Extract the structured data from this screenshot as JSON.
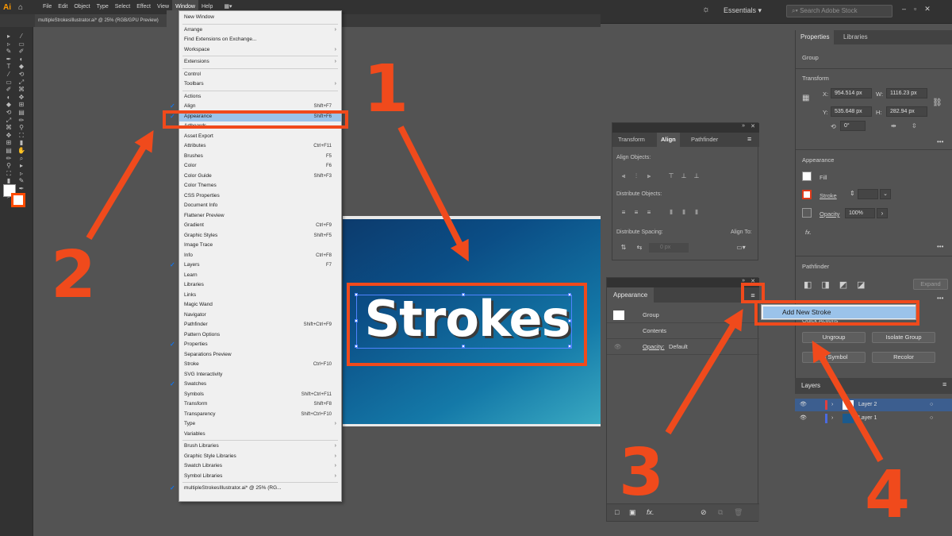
{
  "left": {
    "app_logo": "Ai",
    "menubar": [
      "File",
      "Edit",
      "Object",
      "Type",
      "Select",
      "Effect",
      "View",
      "Window",
      "Help"
    ],
    "active_menu": "Window",
    "doc_tab": "multipleStrokesIllustrator.ai* @ 25% (RGB/GPU Preview)",
    "canvas_text": "Strokes",
    "window_menu": {
      "items": [
        {
          "label": "New Window",
          "sc": "",
          "sub": false,
          "chk": false
        },
        {
          "sep": true
        },
        {
          "label": "Arrange",
          "sc": "",
          "sub": true,
          "chk": false
        },
        {
          "label": "Find Extensions on Exchange...",
          "sc": "",
          "sub": false,
          "chk": false
        },
        {
          "label": "Workspace",
          "sc": "",
          "sub": true,
          "chk": false
        },
        {
          "sep": true
        },
        {
          "label": "Extensions",
          "sc": "",
          "sub": true,
          "chk": false
        },
        {
          "sep": true
        },
        {
          "label": "Control",
          "sc": "",
          "sub": false,
          "chk": false
        },
        {
          "label": "Toolbars",
          "sc": "",
          "sub": true,
          "chk": false
        },
        {
          "sep": true
        },
        {
          "label": "Actions",
          "sc": "",
          "sub": false,
          "chk": false
        },
        {
          "label": "Align",
          "sc": "Shift+F7",
          "sub": false,
          "chk": true
        },
        {
          "label": "Appearance",
          "sc": "Shift+F6",
          "sub": false,
          "chk": true,
          "hl": true
        },
        {
          "label": "Artboards",
          "sc": "",
          "sub": false,
          "chk": false
        },
        {
          "label": "Asset Export",
          "sc": "",
          "sub": false,
          "chk": false
        },
        {
          "label": "Attributes",
          "sc": "Ctrl+F11",
          "sub": false,
          "chk": false
        },
        {
          "label": "Brushes",
          "sc": "F5",
          "sub": false,
          "chk": false
        },
        {
          "label": "Color",
          "sc": "F6",
          "sub": false,
          "chk": false
        },
        {
          "label": "Color Guide",
          "sc": "Shift+F3",
          "sub": false,
          "chk": false
        },
        {
          "label": "Color Themes",
          "sc": "",
          "sub": false,
          "chk": false
        },
        {
          "label": "CSS Properties",
          "sc": "",
          "sub": false,
          "chk": false
        },
        {
          "label": "Document Info",
          "sc": "",
          "sub": false,
          "chk": false
        },
        {
          "label": "Flattener Preview",
          "sc": "",
          "sub": false,
          "chk": false
        },
        {
          "label": "Gradient",
          "sc": "Ctrl+F9",
          "sub": false,
          "chk": false
        },
        {
          "label": "Graphic Styles",
          "sc": "Shift+F5",
          "sub": false,
          "chk": false
        },
        {
          "label": "Image Trace",
          "sc": "",
          "sub": false,
          "chk": false
        },
        {
          "label": "Info",
          "sc": "Ctrl+F8",
          "sub": false,
          "chk": false
        },
        {
          "label": "Layers",
          "sc": "F7",
          "sub": false,
          "chk": true
        },
        {
          "label": "Learn",
          "sc": "",
          "sub": false,
          "chk": false
        },
        {
          "label": "Libraries",
          "sc": "",
          "sub": false,
          "chk": false
        },
        {
          "label": "Links",
          "sc": "",
          "sub": false,
          "chk": false
        },
        {
          "label": "Magic Wand",
          "sc": "",
          "sub": false,
          "chk": false
        },
        {
          "label": "Navigator",
          "sc": "",
          "sub": false,
          "chk": false
        },
        {
          "label": "Pathfinder",
          "sc": "Shift+Ctrl+F9",
          "sub": false,
          "chk": false
        },
        {
          "label": "Pattern Options",
          "sc": "",
          "sub": false,
          "chk": false
        },
        {
          "label": "Properties",
          "sc": "",
          "sub": false,
          "chk": true
        },
        {
          "label": "Separations Preview",
          "sc": "",
          "sub": false,
          "chk": false
        },
        {
          "label": "Stroke",
          "sc": "Ctrl+F10",
          "sub": false,
          "chk": false
        },
        {
          "label": "SVG Interactivity",
          "sc": "",
          "sub": false,
          "chk": false
        },
        {
          "label": "Swatches",
          "sc": "",
          "sub": false,
          "chk": true
        },
        {
          "label": "Symbols",
          "sc": "Shift+Ctrl+F11",
          "sub": false,
          "chk": false
        },
        {
          "label": "Transform",
          "sc": "Shift+F8",
          "sub": false,
          "chk": false
        },
        {
          "label": "Transparency",
          "sc": "Shift+Ctrl+F10",
          "sub": false,
          "chk": false
        },
        {
          "label": "Type",
          "sc": "",
          "sub": true,
          "chk": false
        },
        {
          "label": "Variables",
          "sc": "",
          "sub": false,
          "chk": false
        },
        {
          "sep": true
        },
        {
          "label": "Brush Libraries",
          "sc": "",
          "sub": true,
          "chk": false
        },
        {
          "label": "Graphic Style Libraries",
          "sc": "",
          "sub": true,
          "chk": false
        },
        {
          "label": "Swatch Libraries",
          "sc": "",
          "sub": true,
          "chk": false
        },
        {
          "label": "Symbol Libraries",
          "sc": "",
          "sub": true,
          "chk": false
        },
        {
          "sep": true
        },
        {
          "label": "multipleStrokesIllustrator.ai* @ 25% (RG...",
          "sc": "",
          "sub": false,
          "chk": true
        }
      ]
    }
  },
  "right": {
    "workspace": "Essentials",
    "search_placeholder": "Search Adobe Stock",
    "properties": {
      "tabs": [
        "Properties",
        "Libraries"
      ],
      "selection": "Group",
      "transform_label": "Transform",
      "x_label": "X:",
      "x": "954.514 px",
      "y_label": "Y:",
      "y": "535.648 px",
      "w_label": "W:",
      "w": "1116.23 px",
      "h_label": "H:",
      "h": "282.94 px",
      "angle": "0°",
      "appearance_label": "Appearance",
      "fill_label": "Fill",
      "stroke_label": "Stroke",
      "opacity_label": "Opacity",
      "opacity": "100%",
      "fx": "fx.",
      "pathfinder_label": "Pathfinder",
      "expand": "Expand",
      "quick_actions": "Quick Actions",
      "ungroup": "Ungroup",
      "isolate": "Isolate Group",
      "make_symbol": "as Symbol",
      "recolor": "Recolor"
    },
    "align": {
      "tabs": [
        "Transform",
        "Align",
        "Pathfinder"
      ],
      "align_objects": "Align Objects:",
      "distribute_objects": "Distribute Objects:",
      "distribute_spacing": "Distribute Spacing:",
      "align_to": "Align To:",
      "spacing_value": "0 px"
    },
    "appearance": {
      "title": "Appearance",
      "group": "Group",
      "contents": "Contents",
      "opacity_row": "Opacity:",
      "opacity_value": "Default",
      "fx": "fx."
    },
    "flyout_item": "Add New Stroke",
    "layers": {
      "title": "Layers",
      "rows": [
        "Layer 2",
        "Layer 1"
      ]
    }
  },
  "annotations": {
    "numbers": [
      "1",
      "2",
      "3",
      "4"
    ],
    "color": "#f04a1c"
  }
}
